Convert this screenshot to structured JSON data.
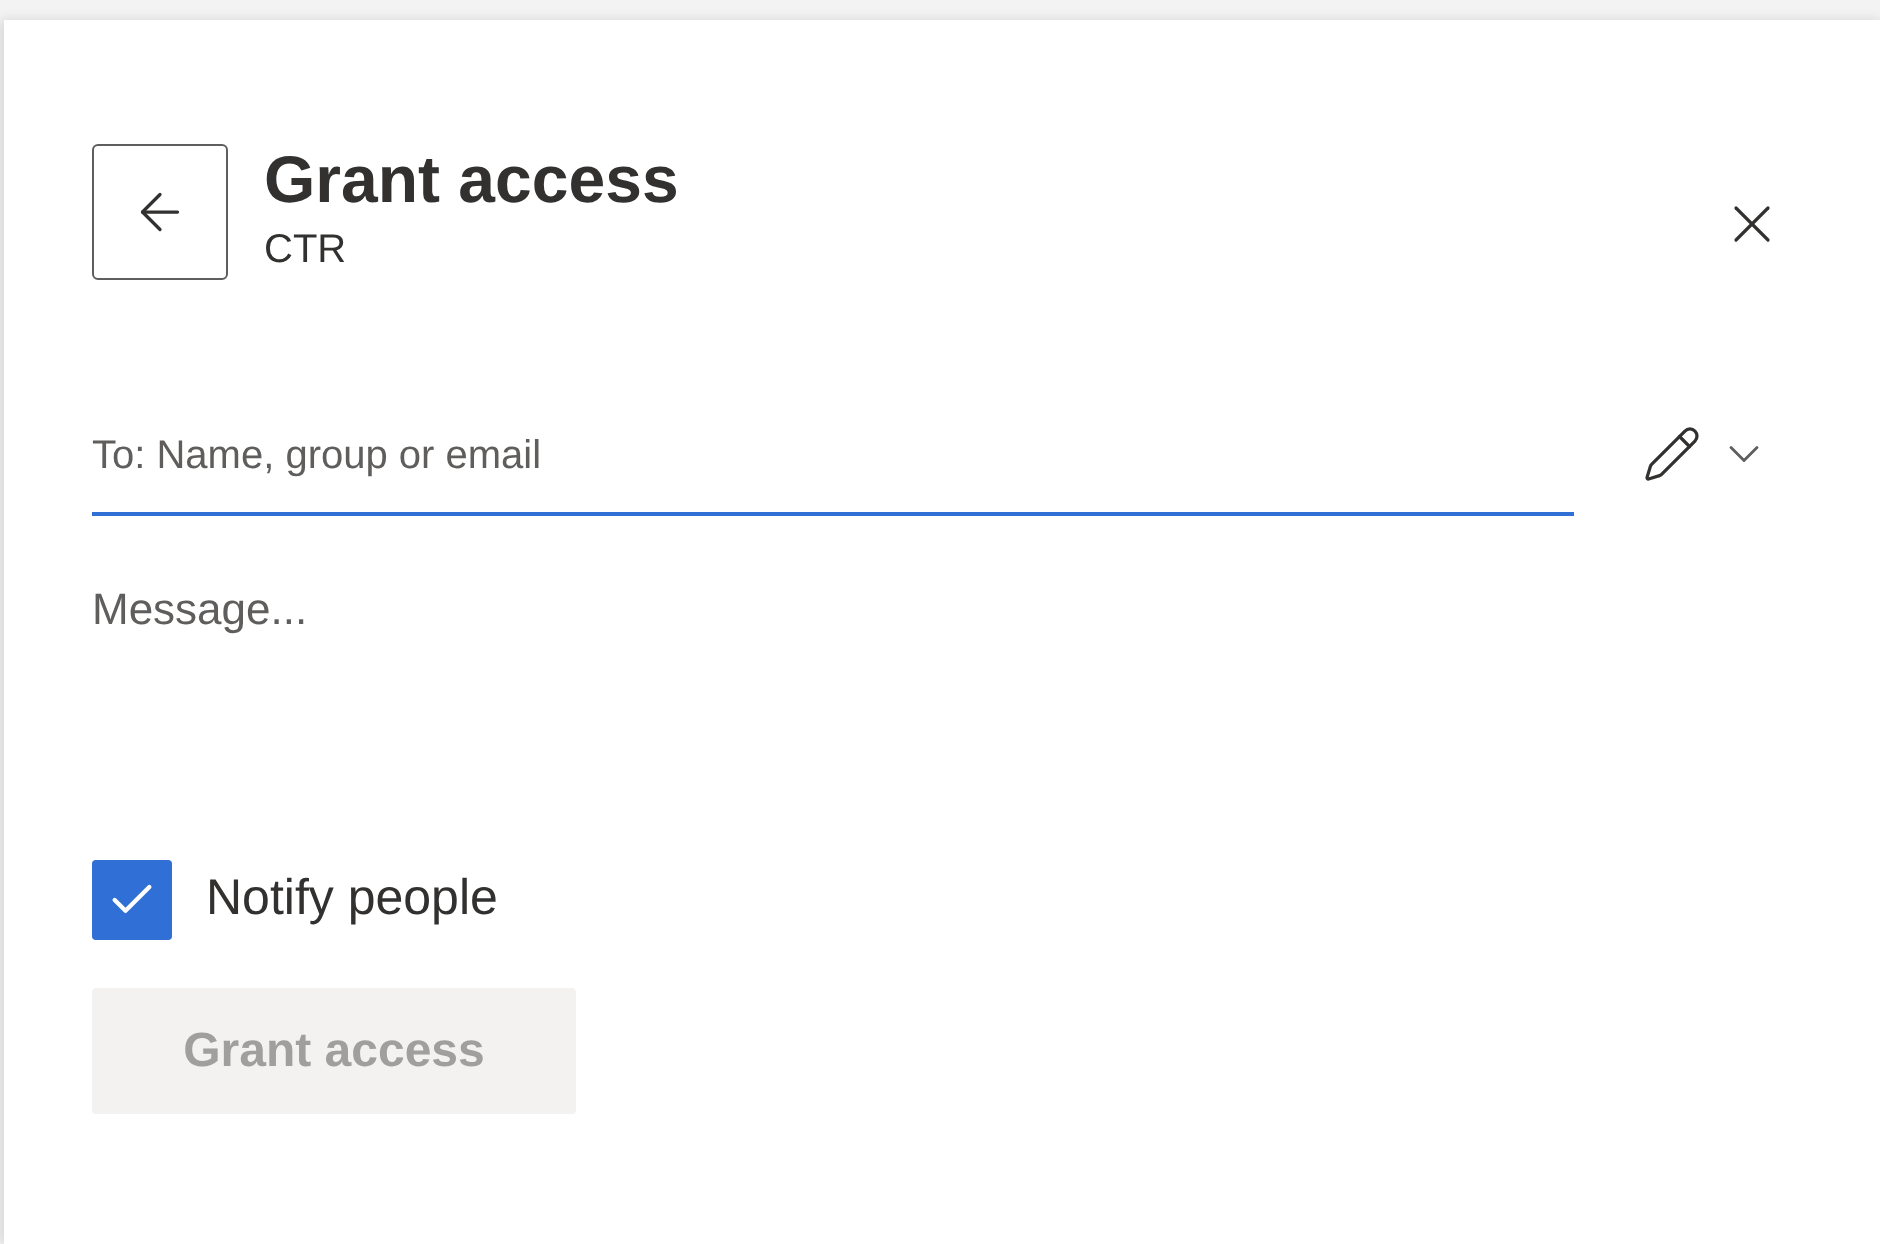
{
  "header": {
    "title": "Grant access",
    "subtitle": "CTR"
  },
  "recipients": {
    "placeholder": "To: Name, group or email"
  },
  "message": {
    "placeholder": "Message..."
  },
  "notify": {
    "label": "Notify people",
    "checked": true
  },
  "submit": {
    "label": "Grant access",
    "disabled": true
  }
}
